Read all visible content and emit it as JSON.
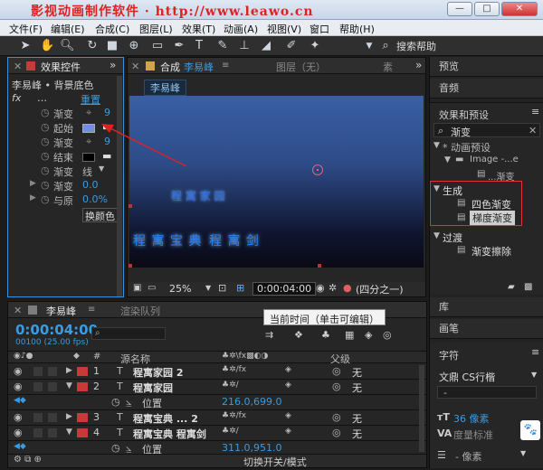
{
  "window": {
    "title": "影视动画制作软件 · http://www.leawo.cn",
    "min_label": "—",
    "max_label": "□",
    "close_label": "✕"
  },
  "menu": [
    "文件(F)",
    "编辑(E)",
    "合成(C)",
    "图层(L)",
    "效果(T)",
    "动画(A)",
    "视图(V)",
    "窗口",
    "帮助(H)"
  ],
  "toolbar": {
    "search_help": "搜索帮助",
    "icons": [
      "selection-tool",
      "hand-tool",
      "zoom-tool",
      "rotate-tool",
      "camera-tool",
      "pan-behind-tool",
      "rectangle-tool",
      "pen-tool",
      "text-tool",
      "brush-tool",
      "clone-stamp-tool",
      "eraser-tool",
      "roto-brush-tool",
      "puppet-pin-tool"
    ]
  },
  "effect_controls": {
    "tab_label": "效果控件",
    "layer_path": "李易峰 • 背景底色",
    "fx_label": "fx",
    "fx_dots": "…",
    "reset": "重置",
    "rows": [
      {
        "label": "渐变",
        "value": "9"
      },
      {
        "label": "起始",
        "value": ""
      },
      {
        "label": "渐变",
        "value": "9"
      },
      {
        "label": "结束",
        "value": ""
      },
      {
        "label": "渐变",
        "value": "线"
      },
      {
        "label": "渐变",
        "value": "0.0"
      },
      {
        "label": "与原",
        "value": "0.0%"
      },
      {
        "label": "",
        "value": "换颜色"
      }
    ],
    "start_color": "#6f8fe0",
    "end_color": "#000000"
  },
  "composition": {
    "tab_prefix": "合成",
    "tab_name": "李易峰",
    "layer_tab": "图层（无）",
    "footage_tab": "素",
    "comp_chip": "李易峰",
    "canvas_texts": {
      "top": "程 寓 家 园",
      "bottom_left": "程 寓 宝 典",
      "bottom_right": "程 寓 剑"
    },
    "zoom": "25%",
    "timecode": "0:00:04:00",
    "quality": "(四分之一)",
    "gradient_top": "#3a5fa6",
    "gradient_bottom": "#0a0a14"
  },
  "right_panels": {
    "preview": "预览",
    "audio": "音频",
    "effects_presets": "效果和预设",
    "search_value": "渐变",
    "tree": [
      {
        "label": "* 动画预设",
        "level": 0,
        "expanded": true
      },
      {
        "label": "Image -...e",
        "level": 1,
        "expanded": true
      },
      {
        "label": "...渐变",
        "level": 2
      },
      {
        "label": "生成",
        "level": 0,
        "expanded": true
      },
      {
        "label": "四色渐变",
        "level": 1
      },
      {
        "label": "梯度渐变",
        "level": 1,
        "selected": true
      },
      {
        "label": "过渡",
        "level": 0,
        "expanded": true
      },
      {
        "label": "渐变擦除",
        "level": 1
      }
    ],
    "library": "库",
    "brush": "画笔",
    "character": "字符",
    "font_name": "文鼎 CS行楷",
    "font_style": "-",
    "font_size": "36 像素",
    "tracking_label": "度量标准",
    "leading": "- 像素"
  },
  "timeline": {
    "tab_name": "李易峰",
    "render_queue_tab": "渲染队列",
    "tooltip": "当前时间（单击可编辑）",
    "current_time": "0:00:04:00",
    "frame_info": "00100 (25.00 fps)",
    "col_source_name": "源名称",
    "col_parent": "父级",
    "switch_label": "切换开关/模式",
    "layers": [
      {
        "num": "1",
        "name": "程寓家园 2",
        "parent": "无",
        "expanded": false
      },
      {
        "num": "2",
        "name": "程寓家园",
        "parent": "无",
        "expanded": true
      },
      {
        "num": "3",
        "name": "程寓宝典 ... 2",
        "parent": "无",
        "expanded": false
      },
      {
        "num": "4",
        "name": "程寓宝典   程寓剑",
        "parent": "无",
        "expanded": true
      }
    ],
    "prop_rows": [
      {
        "after_layer": "2",
        "name": "位置",
        "value": "216.0,699.0"
      },
      {
        "after_layer": "4",
        "name": "位置",
        "value": "311.0,951.0"
      }
    ],
    "label_color": "#c83a3a"
  },
  "colors": {
    "accent_blue": "#3b9be0",
    "highlight_border": "#3b8fd4",
    "annotation_red": "#dd2222"
  }
}
